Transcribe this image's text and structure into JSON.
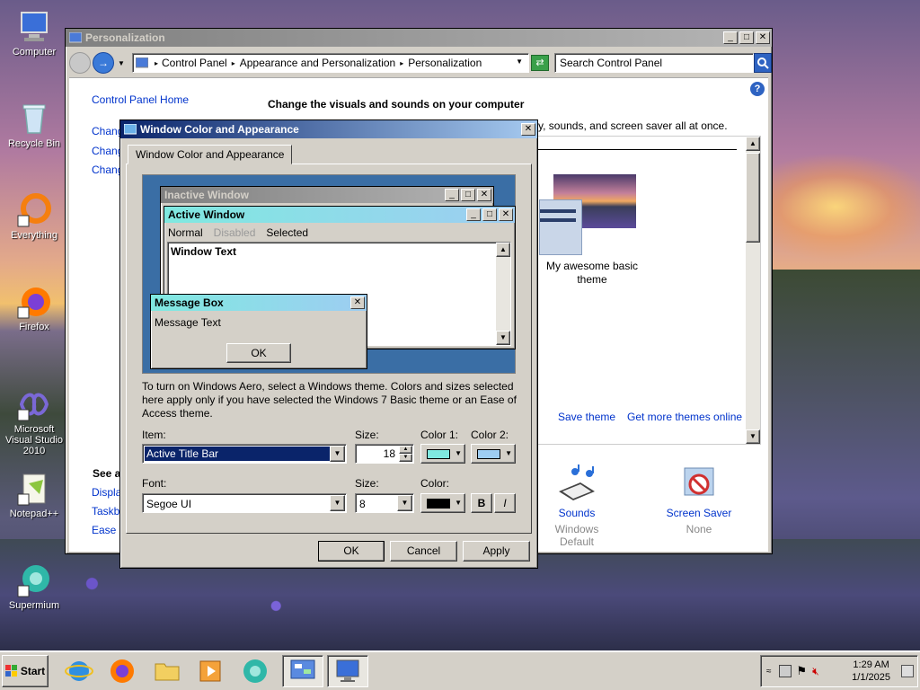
{
  "desktop": {
    "icons": [
      {
        "label": "Computer"
      },
      {
        "label": "Recycle Bin"
      },
      {
        "label": "Everything"
      },
      {
        "label": "Firefox"
      },
      {
        "label": "Microsoft Visual Studio 2010"
      },
      {
        "label": "Notepad++"
      },
      {
        "label": "Supermium"
      }
    ]
  },
  "explorer": {
    "title": "Personalization",
    "breadcrumb": [
      "Control Panel",
      "Appearance and Personalization",
      "Personalization"
    ],
    "search_placeholder": "Search Control Panel",
    "sidebar": {
      "home": "Control Panel Home",
      "links": [
        "Chang",
        "Chang",
        "Chang"
      ],
      "see_also": "See a",
      "see_also_links": [
        "Displa",
        "Taskba",
        "Ease o"
      ]
    },
    "heading": "Change the visuals and sounds on your computer",
    "subheading": "y, sounds, and screen saver all at once.",
    "theme_name": "My awesome basic theme",
    "save_theme": "Save theme",
    "get_more": "Get more themes online",
    "sounds": {
      "label": "Sounds",
      "sub": "Windows Default"
    },
    "screensaver": {
      "label": "Screen Saver",
      "sub": "None"
    }
  },
  "dialog": {
    "title": "Window Color and Appearance",
    "tab": "Window Color and Appearance",
    "preview": {
      "inactive_title": "Inactive Window",
      "active_title": "Active Window",
      "menu": [
        "Normal",
        "Disabled",
        "Selected"
      ],
      "window_text": "Window Text",
      "msgbox_title": "Message Box",
      "msgbox_text": "Message Text",
      "msgbox_ok": "OK"
    },
    "info": "To turn on Windows Aero, select a Windows theme.  Colors and sizes selected here apply only if you have selected the Windows 7 Basic theme or an Ease of Access theme.",
    "item_label": "Item:",
    "item_value": "Active Title Bar",
    "size_label": "Size:",
    "size_value": "18",
    "color1_label": "Color 1:",
    "color2_label": "Color 2:",
    "color1": "#7fe9e0",
    "color2": "#9ecdf2",
    "font_label": "Font:",
    "font_value": "Segoe UI",
    "font_size_label": "Size:",
    "font_size_value": "8",
    "font_color_label": "Color:",
    "font_color": "#000000",
    "bold": "B",
    "italic": "I",
    "ok": "OK",
    "cancel": "Cancel",
    "apply": "Apply"
  },
  "taskbar": {
    "start": "Start",
    "time": "1:29 AM",
    "date": "1/1/2025"
  }
}
